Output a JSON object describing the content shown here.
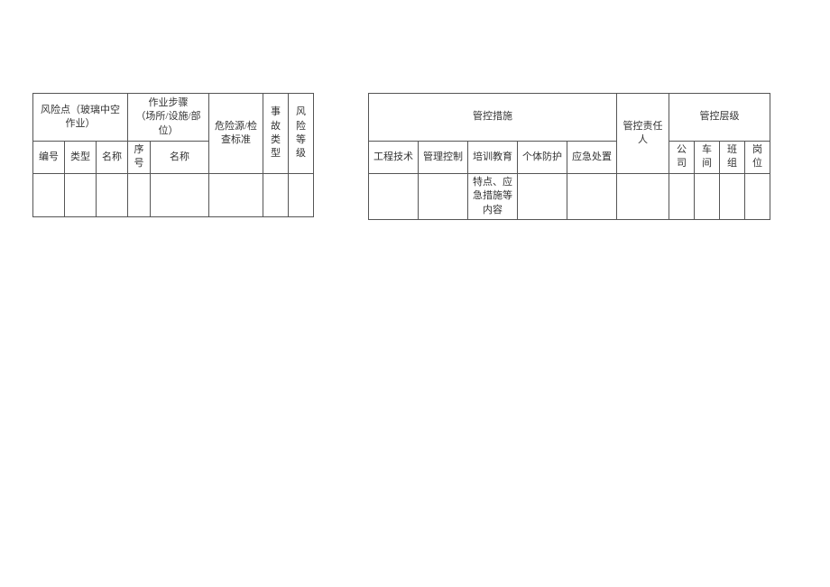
{
  "left_table": {
    "risk_point_header": "风险点（玻璃中空作业）",
    "risk_point_sub": {
      "c1": "编号",
      "c2": "类型",
      "c3": "名称"
    },
    "work_step_header": "作业步骤\n（场所/设施/部位）",
    "work_step_sub": {
      "c1": "序号",
      "c2": "名称"
    },
    "hazard_header": "危险源/检查标准",
    "accident_type_header": "事故类型",
    "risk_level_header": "风险等级",
    "row": {
      "c1": "",
      "c2": "",
      "c3": "",
      "c4": "",
      "c5": "",
      "c6": "",
      "c7": "",
      "c8": ""
    }
  },
  "right_table": {
    "control_measures_header": "管控措施",
    "control_measures_sub": {
      "c1": "工程技术",
      "c2": "管理控制",
      "c3": "培训教育",
      "c4": "个体防护",
      "c5": "应急处置"
    },
    "responsible_header": "管控责任人",
    "control_level_header": "管控层级",
    "control_level_sub": {
      "c1": "公司",
      "c2": "车间",
      "c3": "班组",
      "c4": "岗位"
    },
    "row": {
      "c1": "",
      "c2": "",
      "c3": "特点、应急措施等内容",
      "c4": "",
      "c5": "",
      "c6": "",
      "c7": "",
      "c8": "",
      "c9": "",
      "c10": ""
    }
  }
}
